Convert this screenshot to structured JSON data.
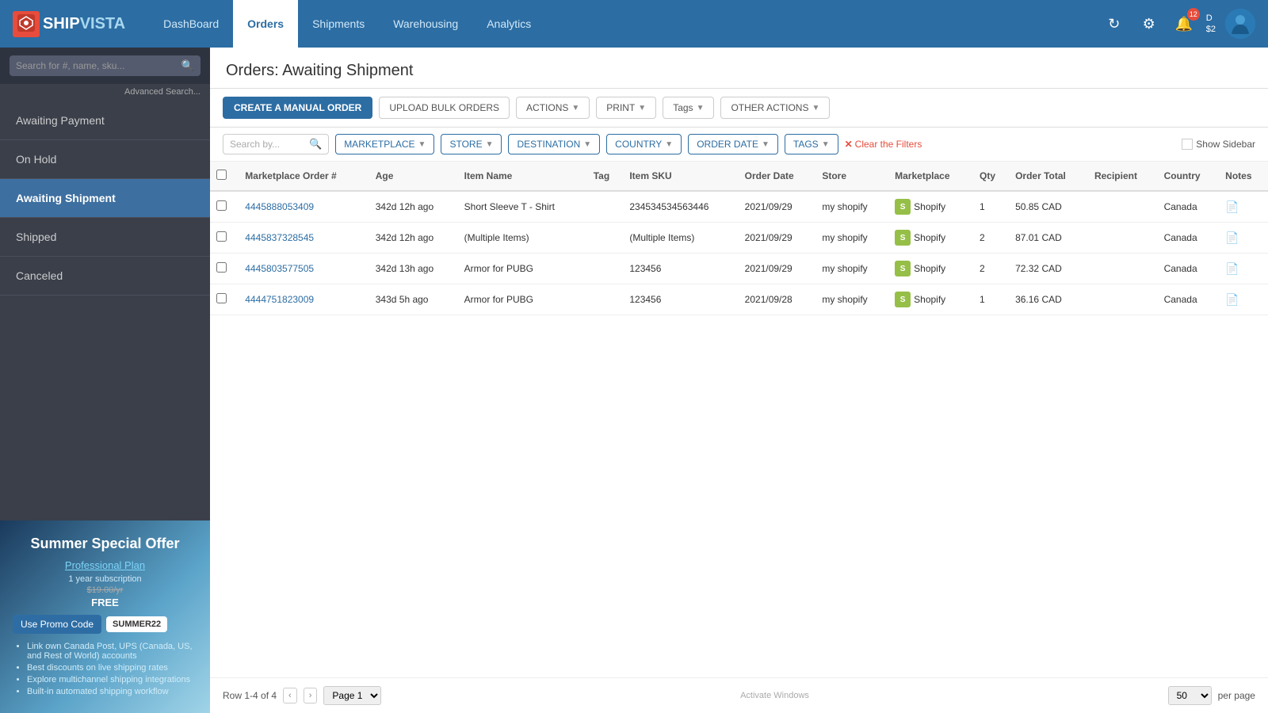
{
  "app": {
    "logo_prefix": "SHIP",
    "logo_suffix": "VISTA",
    "nav_items": [
      "DashBoard",
      "Orders",
      "Shipments",
      "Warehousing",
      "Analytics"
    ],
    "active_nav": "Orders",
    "notif_count": "12",
    "user_label": "D",
    "user_balance": "$2"
  },
  "sidebar": {
    "search_placeholder": "Search for #, name, sku...",
    "advanced_search": "Advanced Search...",
    "nav_items": [
      {
        "label": "Awaiting Payment",
        "active": false
      },
      {
        "label": "On Hold",
        "active": false
      },
      {
        "label": "Awaiting Shipment",
        "active": true
      },
      {
        "label": "Shipped",
        "active": false
      },
      {
        "label": "Canceled",
        "active": false
      }
    ]
  },
  "promo": {
    "title": "Summer Special Offer",
    "plan_label": "Professional Plan",
    "subscription": "1 year subscription",
    "old_price": "$19.00/yr",
    "free_label": "FREE",
    "code_btn": "Use Promo Code",
    "code_value": "SUMMER22",
    "bullets": [
      "Link own Canada Post, UPS (Canada, US, and Rest of World) accounts",
      "Best discounts on live shipping rates",
      "Explore multichannel shipping integrations",
      "Built-in automated shipping workflow"
    ]
  },
  "content": {
    "page_title": "Orders: Awaiting Shipment",
    "toolbar": {
      "create_btn": "CREATE A MANUAL ORDER",
      "upload_btn": "UPLOAD BULK ORDERS",
      "actions_btn": "ACTIONS",
      "print_btn": "PRINT",
      "tags_btn": "Tags",
      "other_actions_btn": "OTHER ACTIONS"
    },
    "filters": {
      "search_placeholder": "Search by...",
      "marketplace_btn": "MARKETPLACE",
      "store_btn": "STORE",
      "destination_btn": "DESTINATION",
      "country_btn": "COUNTRY",
      "order_date_btn": "ORDER DATE",
      "tags_btn": "TAGS",
      "clear_filters": "Clear the Filters",
      "show_sidebar": "Show Sidebar"
    },
    "table": {
      "headers": [
        "",
        "Marketplace Order #",
        "Age",
        "Item Name",
        "Tag",
        "Item SKU",
        "Order Date",
        "Store",
        "Marketplace",
        "Qty",
        "Order Total",
        "Recipient",
        "Country",
        "Notes"
      ],
      "rows": [
        {
          "id": "4445888053409",
          "age": "342d 12h ago",
          "item_name": "Short Sleeve T - Shirt",
          "tag": "",
          "sku": "234534534563446",
          "order_date": "2021/09/29",
          "store": "my shopify",
          "marketplace": "Shopify",
          "qty": "1",
          "order_total": "50.85 CAD",
          "recipient": "",
          "country": "Canada",
          "notes": "📄"
        },
        {
          "id": "4445837328545",
          "age": "342d 12h ago",
          "item_name": "(Multiple Items)",
          "tag": "",
          "sku": "(Multiple Items)",
          "order_date": "2021/09/29",
          "store": "my shopify",
          "marketplace": "Shopify",
          "qty": "2",
          "order_total": "87.01 CAD",
          "recipient": "",
          "country": "Canada",
          "notes": "📄"
        },
        {
          "id": "4445803577505",
          "age": "342d 13h ago",
          "item_name": "Armor for PUBG",
          "tag": "",
          "sku": "123456",
          "order_date": "2021/09/29",
          "store": "my shopify",
          "marketplace": "Shopify",
          "qty": "2",
          "order_total": "72.32 CAD",
          "recipient": "",
          "country": "Canada",
          "notes": "📄"
        },
        {
          "id": "4444751823009",
          "age": "343d 5h ago",
          "item_name": "Armor for PUBG",
          "tag": "",
          "sku": "123456",
          "order_date": "2021/09/28",
          "store": "my shopify",
          "marketplace": "Shopify",
          "qty": "1",
          "order_total": "36.16 CAD",
          "recipient": "",
          "country": "Canada",
          "notes": "📄"
        }
      ]
    },
    "pagination": {
      "rows_label": "Row 1-4 of 4",
      "page": "Page 1",
      "per_page": "50",
      "per_page_label": "per page"
    }
  },
  "windows": {
    "activate_label": "Activate Windows"
  }
}
